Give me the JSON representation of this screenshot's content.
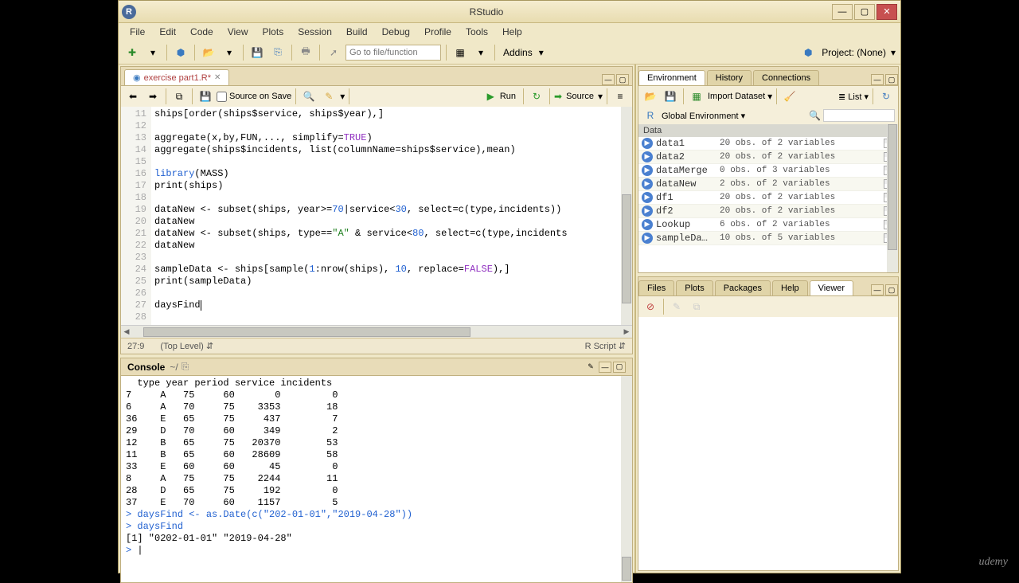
{
  "window": {
    "title": "RStudio"
  },
  "menu": {
    "file": "File",
    "edit": "Edit",
    "code": "Code",
    "view": "View",
    "plots": "Plots",
    "session": "Session",
    "build": "Build",
    "debug": "Debug",
    "profile": "Profile",
    "tools": "Tools",
    "help": "Help"
  },
  "toolbar": {
    "goto_placeholder": "Go to file/function",
    "addins": "Addins",
    "project": "Project: (None)"
  },
  "source": {
    "tab": "exercise part1.R*",
    "source_on_save": "Source on Save",
    "run": "Run",
    "source_btn": "Source",
    "lines": [
      {
        "n": "11",
        "html": "ships[order(ships$service, ships$year),]"
      },
      {
        "n": "12",
        "html": ""
      },
      {
        "n": "13",
        "html": "aggregate(x,by,FUN,..., simplify=<span class='bool'>TRUE</span>)"
      },
      {
        "n": "14",
        "html": "aggregate(ships$incidents, list(columnName=ships$service),mean)"
      },
      {
        "n": "15",
        "html": ""
      },
      {
        "n": "16",
        "html": "<span class='kw'>library</span>(MASS)"
      },
      {
        "n": "17",
        "html": "print(ships)"
      },
      {
        "n": "18",
        "html": ""
      },
      {
        "n": "19",
        "html": "dataNew <- subset(ships, year>=<span class='num'>70</span>|service<<span class='num'>30</span>, select=c(type,incidents))"
      },
      {
        "n": "20",
        "html": "dataNew"
      },
      {
        "n": "21",
        "html": "dataNew <- subset(ships, type==<span class='str'>\"A\"</span> & service<<span class='num'>80</span>, select=c(type,incidents"
      },
      {
        "n": "22",
        "html": "dataNew"
      },
      {
        "n": "23",
        "html": ""
      },
      {
        "n": "24",
        "html": "sampleData <- ships[sample(<span class='num'>1</span>:nrow(ships), <span class='num'>10</span>, replace=<span class='bool'>FALSE</span>),]"
      },
      {
        "n": "25",
        "html": "print(sampleData)"
      },
      {
        "n": "26",
        "html": ""
      },
      {
        "n": "27",
        "html": "daysFind<span class='cursor'></span>"
      },
      {
        "n": "28",
        "html": ""
      }
    ],
    "cursor_pos": "27:9",
    "scope": "(Top Level)",
    "lang": "R Script"
  },
  "console": {
    "title": "Console",
    "path": "~/",
    "header": "  type year period service incidents",
    "rows": [
      "7     A   75     60       0         0",
      "6     A   70     75    3353        18",
      "36    E   65     75     437         7",
      "29    D   70     60     349         2",
      "12    B   65     75   20370        53",
      "11    B   65     60   28609        58",
      "33    E   60     60      45         0",
      "8     A   75     75    2244        11",
      "28    D   65     75     192         0",
      "37    E   70     60    1157         5"
    ],
    "cmd1": "daysFind <- as.Date(c(\"202-01-01\",\"2019-04-28\"))",
    "cmd2": "daysFind",
    "out": "[1] \"0202-01-01\" \"2019-04-28\""
  },
  "env": {
    "tabs": {
      "environment": "Environment",
      "history": "History",
      "connections": "Connections"
    },
    "import": "Import Dataset",
    "list": "List",
    "scope": "Global Environment",
    "section": "Data",
    "items": [
      {
        "name": "data1",
        "val": "20 obs. of 2 variables"
      },
      {
        "name": "data2",
        "val": "20 obs. of 2 variables"
      },
      {
        "name": "dataMerge",
        "val": "0 obs. of 3 variables"
      },
      {
        "name": "dataNew",
        "val": "2 obs. of 2 variables"
      },
      {
        "name": "df1",
        "val": "20 obs. of 2 variables"
      },
      {
        "name": "df2",
        "val": "20 obs. of 2 variables"
      },
      {
        "name": "Lookup",
        "val": "6 obs. of 2 variables"
      },
      {
        "name": "sampleDa…",
        "val": "10 obs. of 5 variables"
      }
    ]
  },
  "viewer": {
    "tabs": {
      "files": "Files",
      "plots": "Plots",
      "packages": "Packages",
      "help": "Help",
      "viewer": "Viewer"
    }
  },
  "branding": "udemy"
}
